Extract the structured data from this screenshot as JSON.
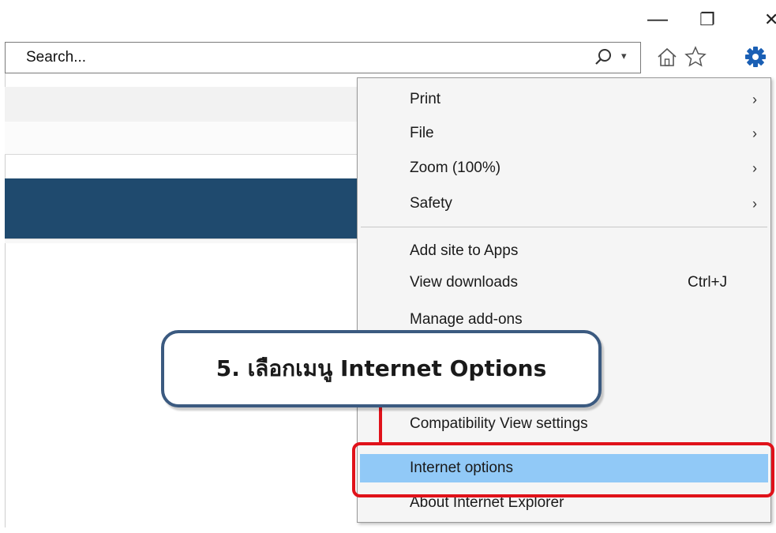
{
  "window": {
    "minimize": "—",
    "restore": "❐",
    "close": "✕"
  },
  "search": {
    "value": "Search...",
    "dropdown_glyph": "▾"
  },
  "toolbar": {
    "icons": [
      "home-icon",
      "favorites-star-icon",
      "gear-icon"
    ]
  },
  "menu": {
    "items": [
      {
        "label": "Print",
        "submenu": "›"
      },
      {
        "label": "File",
        "submenu": "›"
      },
      {
        "label": "Zoom (100%)",
        "submenu": "›"
      },
      {
        "label": "Safety",
        "submenu": "›"
      },
      {
        "label": "Add site to Apps"
      },
      {
        "label": "View downloads",
        "shortcut": "Ctrl+J"
      },
      {
        "label": "Manage add-ons"
      },
      {
        "label": "Compatibility View settings"
      },
      {
        "label": "Internet options"
      },
      {
        "label": "About Internet Explorer"
      }
    ]
  },
  "callout": {
    "text": "5. เลือกเมนู Internet Options"
  },
  "colors": {
    "highlight": "#91c9f7",
    "annotation_red": "#e0121a",
    "callout_border": "#3b5a80",
    "page_banner": "#1f4a6e",
    "gear": "#1a5fb4"
  }
}
